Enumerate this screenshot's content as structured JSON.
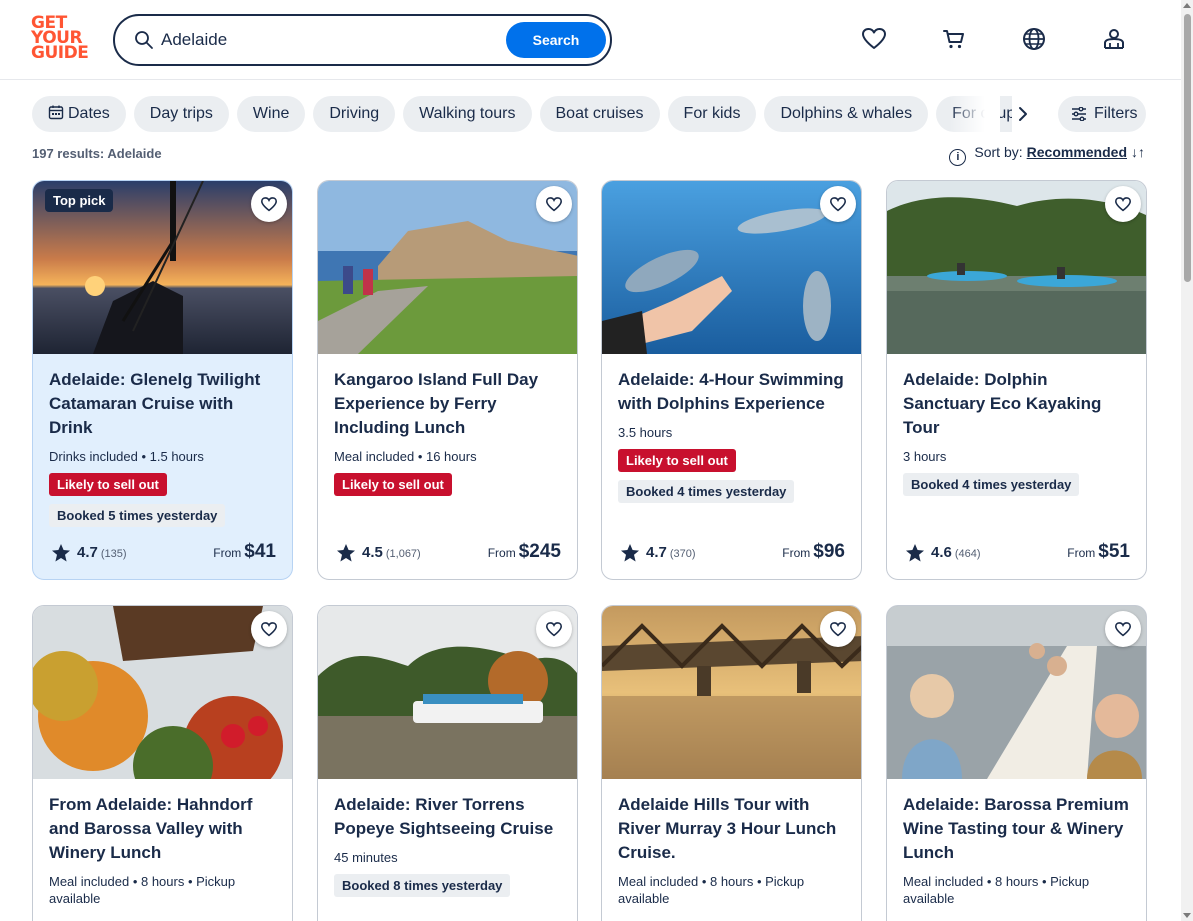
{
  "header": {
    "logo_lines": [
      "GET",
      "YOUR",
      "GUIDE"
    ],
    "search_value": "Adelaide",
    "search_button": "Search",
    "icons": [
      "heart-icon",
      "cart-icon",
      "globe-icon",
      "user-icon"
    ]
  },
  "chips": {
    "items": [
      "Dates",
      "Day trips",
      "Wine",
      "Driving",
      "Walking tours",
      "Boat cruises",
      "For kids",
      "Dolphins & whales",
      "For couples"
    ],
    "filters": "Filters"
  },
  "results": {
    "summary": "197 results: Adelaide",
    "sort_label": "Sort by:",
    "sort_value": "Recommended"
  },
  "colors": {
    "brand": "#ff5533",
    "primary": "#0071eb",
    "text": "#1a2b49",
    "badge_red": "#c8102e",
    "highlight": "#e1effd"
  },
  "cards": [
    {
      "top_pick": "Top pick",
      "title": "Adelaide: Glenelg Twilight Catamaran Cruise with Drink",
      "meta": "Drinks included • 1.5 hours",
      "red_badge": "Likely to sell out",
      "grey_badge": "Booked 5 times yesterday",
      "rating": "4.7",
      "reviews": "(135)",
      "from": "From",
      "price": "$41"
    },
    {
      "title": "Kangaroo Island Full Day Experience by Ferry Including Lunch",
      "meta": "Meal included • 16 hours",
      "red_badge": "Likely to sell out",
      "rating": "4.5",
      "reviews": "(1,067)",
      "from": "From",
      "price": "$245"
    },
    {
      "title": "Adelaide: 4-Hour Swimming with Dolphins Experience",
      "meta": "3.5 hours",
      "red_badge": "Likely to sell out",
      "grey_badge": "Booked 4 times yesterday",
      "rating": "4.7",
      "reviews": "(370)",
      "from": "From",
      "price": "$96"
    },
    {
      "title": "Adelaide: Dolphin Sanctuary Eco Kayaking Tour",
      "meta": "3 hours",
      "grey_badge": "Booked 4 times yesterday",
      "rating": "4.6",
      "reviews": "(464)",
      "from": "From",
      "price": "$51"
    },
    {
      "title": "From Adelaide: Hahndorf and Barossa Valley with Winery Lunch",
      "meta": "Meal included • 8 hours • Pickup available"
    },
    {
      "title": "Adelaide: River Torrens Popeye Sightseeing Cruise",
      "meta": "45 minutes",
      "grey_badge": "Booked 8 times yesterday"
    },
    {
      "title": "Adelaide Hills Tour with River Murray 3 Hour Lunch Cruise.",
      "meta": "Meal included • 8 hours • Pickup available"
    },
    {
      "title": "Adelaide: Barossa Premium Wine Tasting tour & Winery Lunch",
      "meta": "Meal included • 8 hours • Pickup available"
    }
  ]
}
